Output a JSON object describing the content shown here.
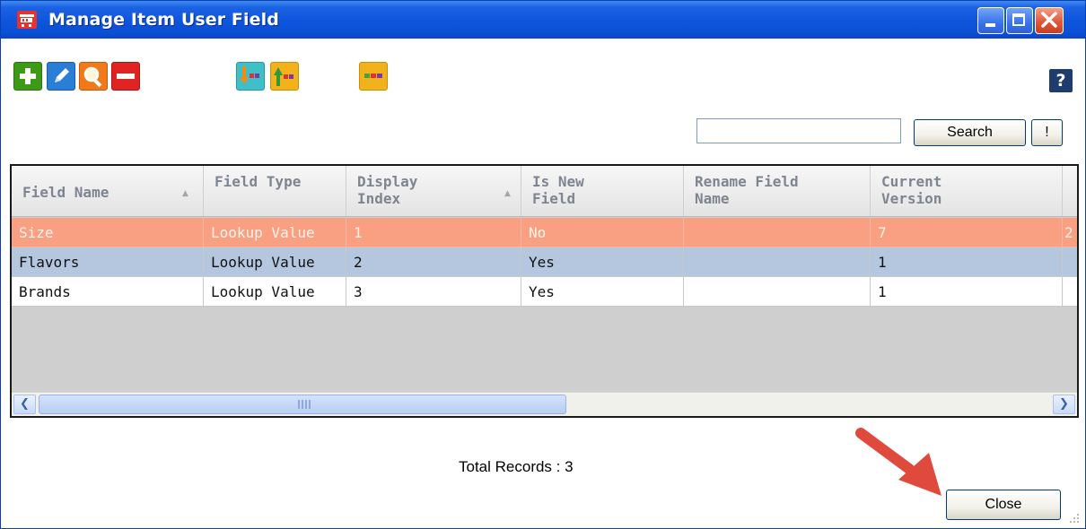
{
  "window": {
    "title": "Manage Item User Field",
    "app_icon": "shopping-cart-icon",
    "controls": [
      "minimize",
      "maximize",
      "close"
    ]
  },
  "toolbar": {
    "buttons": [
      {
        "name": "add",
        "icon": "plus-icon",
        "color": "#3c9a16"
      },
      {
        "name": "edit",
        "icon": "pencil-icon",
        "color": "#2a7fd4"
      },
      {
        "name": "view",
        "icon": "magnifier-icon",
        "color": "#f07a1a"
      },
      {
        "name": "delete",
        "icon": "minus-icon",
        "color": "#e02424"
      },
      {
        "name": "import",
        "icon": "import-arrow-icon",
        "color": "#3fc0c8"
      },
      {
        "name": "export",
        "icon": "export-arrow-icon",
        "color": "#f2b21b"
      },
      {
        "name": "columns",
        "icon": "columns-icon",
        "color": "#f2b21b"
      }
    ],
    "help_label": "?"
  },
  "search": {
    "value": "",
    "button_label": "Search",
    "clear_label": "!"
  },
  "grid": {
    "columns": [
      "Field Name",
      "Field Type",
      "Display Index",
      "Is New Field",
      "Rename Field Name",
      "Current Version",
      ""
    ],
    "sort_indicator": "▲",
    "rows": [
      {
        "field_name": "Size",
        "field_type": "Lookup Value",
        "display_index": "1",
        "is_new_field": "No",
        "rename_field_name": "",
        "current_version": "7",
        "extra": "2",
        "selected": true
      },
      {
        "field_name": "Flavors",
        "field_type": "Lookup Value",
        "display_index": "2",
        "is_new_field": "Yes",
        "rename_field_name": "",
        "current_version": "1",
        "extra": ""
      },
      {
        "field_name": "Brands",
        "field_type": "Lookup Value",
        "display_index": "3",
        "is_new_field": "Yes",
        "rename_field_name": "",
        "current_version": "1",
        "extra": ""
      }
    ]
  },
  "footer": {
    "total_records": "Total Records : 3",
    "close_label": "Close"
  },
  "colors": {
    "title_bar": "#0d55dc",
    "selected_row": "#f99f82",
    "alt_row": "#b4c7df",
    "annotation_arrow": "#e04a3c"
  }
}
